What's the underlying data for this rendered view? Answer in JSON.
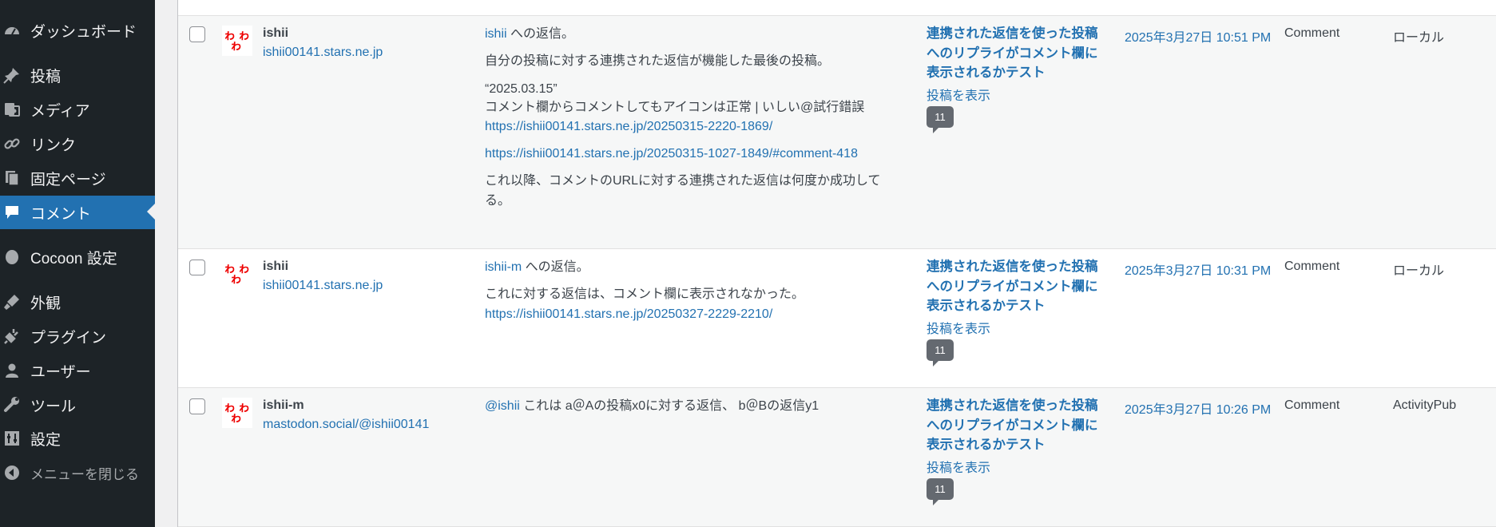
{
  "sidebar": {
    "items": [
      {
        "label": "ダッシュボード",
        "icon": "dashboard-icon"
      },
      {
        "label": "投稿",
        "icon": "pin-icon"
      },
      {
        "label": "メディア",
        "icon": "media-icon"
      },
      {
        "label": "リンク",
        "icon": "link-icon"
      },
      {
        "label": "固定ページ",
        "icon": "page-icon"
      },
      {
        "label": "コメント",
        "icon": "comment-icon",
        "active": true
      },
      {
        "label": "Cocoon 設定",
        "icon": "cocoon-icon"
      },
      {
        "label": "外観",
        "icon": "appearance-icon"
      },
      {
        "label": "プラグイン",
        "icon": "plugin-icon"
      },
      {
        "label": "ユーザー",
        "icon": "user-icon"
      },
      {
        "label": "ツール",
        "icon": "tools-icon"
      },
      {
        "label": "設定",
        "icon": "settings-icon"
      },
      {
        "label": "メニューを閉じる",
        "icon": "collapse-icon"
      }
    ]
  },
  "comments": [
    {
      "author": "ishii",
      "author_url": "ishii00141.stars.ne.jp",
      "reply_to": "ishii",
      "reply_suffix": " への返信。",
      "paragraph1": "自分の投稿に対する連携された返信が機能した最後の投稿。",
      "quote_date": "“2025.03.15”",
      "quote_text": "コメント欄からコメントしてもアイコンは正常 | いしい@試行錯誤",
      "quote_link": "https://ishii00141.stars.ne.jp/20250315-2220-1869/",
      "link2": "https://ishii00141.stars.ne.jp/20250315-1027-1849/#comment-418",
      "paragraph3_line1": "これ以降、コメントのURLに対する連携された返信は何度か成功して",
      "paragraph3_line2": "る。",
      "post_title_lines": [
        "連携された返信を使った投稿",
        "へのリプライがコメント欄に",
        "表示されるかテスト"
      ],
      "view_post": "投稿を表示",
      "comment_count": "11",
      "date": "2025年3月27日 10:51 PM",
      "type": "Comment",
      "protocol": "ローカル"
    },
    {
      "author": "ishii",
      "author_url": "ishii00141.stars.ne.jp",
      "reply_to": "ishii-m",
      "reply_suffix": " への返信。",
      "paragraph1": "これに対する返信は、コメント欄に表示されなかった。",
      "link": "https://ishii00141.stars.ne.jp/20250327-2229-2210/",
      "post_title_lines": [
        "連携された返信を使った投稿",
        "へのリプライがコメント欄に",
        "表示されるかテスト"
      ],
      "view_post": "投稿を表示",
      "comment_count": "11",
      "date": "2025年3月27日 10:31 PM",
      "type": "Comment",
      "protocol": "ローカル"
    },
    {
      "author": "ishii-m",
      "author_url": "mastodon.social/@ishii00141",
      "mention": "@ishii",
      "text": " これは a＠Aの投稿x0に対する返信、 b＠Bの返信y1",
      "post_title_lines": [
        "連携された返信を使った投稿",
        "へのリプライがコメント欄に",
        "表示されるかテスト"
      ],
      "view_post": "投稿を表示",
      "comment_count": "11",
      "date": "2025年3月27日 10:26 PM",
      "type": "Comment",
      "protocol": "ActivityPub"
    }
  ],
  "colors": {
    "sidebar_bg": "#1d2327",
    "active_bg": "#2271b1",
    "link": "#2271b1",
    "bubble": "#646970"
  }
}
